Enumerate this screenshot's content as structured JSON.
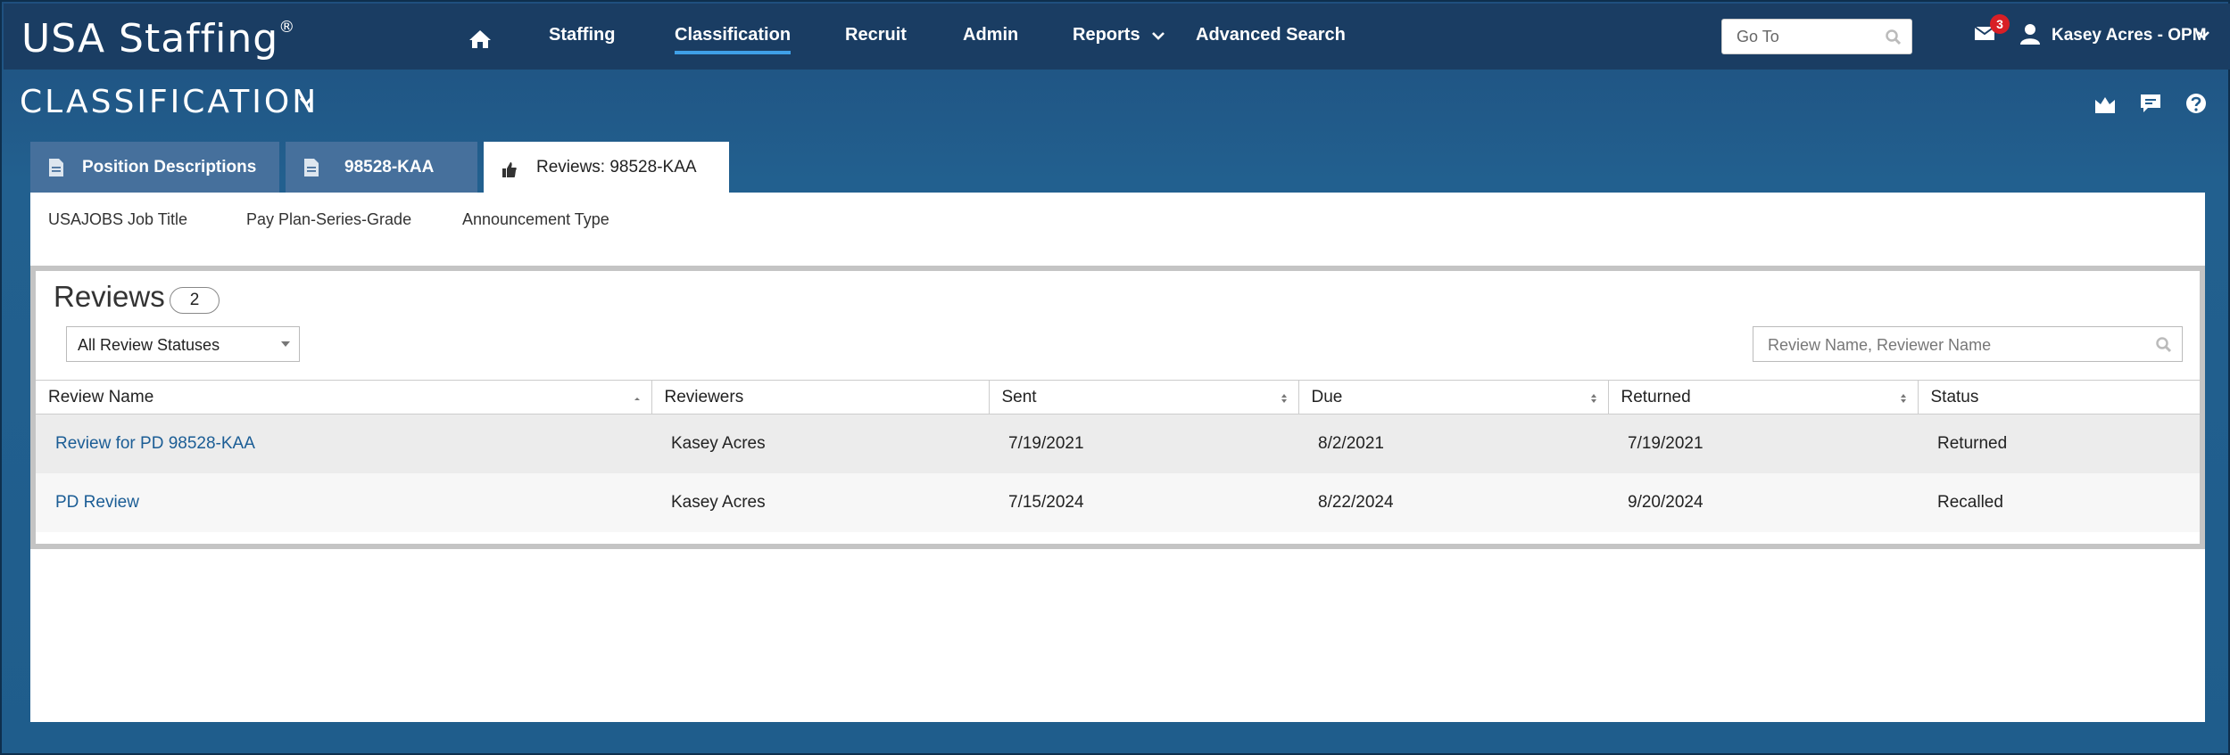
{
  "app": {
    "logo": "USA Staffing",
    "logo_mark": "®"
  },
  "nav": {
    "items": [
      {
        "label": "Staffing"
      },
      {
        "label": "Classification"
      },
      {
        "label": "Recruit"
      },
      {
        "label": "Admin"
      },
      {
        "label": "Reports"
      },
      {
        "label": "Advanced Search"
      }
    ],
    "goto_placeholder": "Go To",
    "notification_count": "3",
    "user": "Kasey Acres - OPM"
  },
  "section": {
    "title": "CLASSIFICATION"
  },
  "tabs": [
    {
      "label": "Position Descriptions",
      "icon": "document-icon"
    },
    {
      "label": "98528-KAA",
      "icon": "document-icon"
    },
    {
      "label": "Reviews: 98528-KAA",
      "icon": "thumbs-up-icon"
    }
  ],
  "fields": {
    "job_title": "USAJOBS Job Title",
    "pay_plan": "Pay Plan-Series-Grade",
    "announcement": "Announcement Type"
  },
  "reviews": {
    "title": "Reviews",
    "count": "2",
    "filter": "All Review Statuses",
    "search_placeholder": "Review Name, Reviewer Name",
    "columns": [
      "Review Name",
      "Reviewers",
      "Sent",
      "Due",
      "Returned",
      "Status"
    ],
    "rows": [
      {
        "name": "Review for PD 98528-KAA",
        "reviewers": "Kasey Acres",
        "sent": "7/19/2021",
        "due": "8/2/2021",
        "returned": "7/19/2021",
        "status": "Returned"
      },
      {
        "name": "PD Review",
        "reviewers": "Kasey Acres",
        "sent": "7/15/2024",
        "due": "8/22/2024",
        "returned": "9/20/2024",
        "status": "Recalled"
      }
    ]
  },
  "colors": {
    "nav_bg": "#1a3d63",
    "page_bg": "#1f5d8c",
    "tab_bg": "#46709c",
    "link": "#1b5d95",
    "badge": "#d81f26",
    "active_underline": "#3fa0e8"
  }
}
